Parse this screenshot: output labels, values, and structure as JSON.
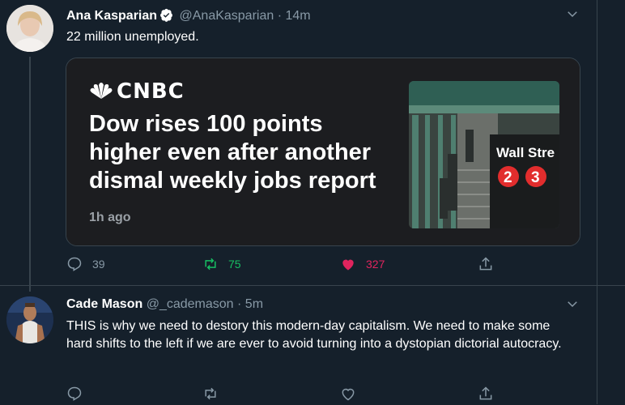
{
  "tweet1": {
    "name": "Ana Kasparian",
    "handle": "@AnaKasparian",
    "time": "· 14m",
    "text": "22 million unemployed.",
    "card": {
      "source": "CNBC",
      "headline": "Dow rises 100 points higher even after another dismal weekly jobs report",
      "time": "1h ago",
      "image_sign": "Wall Stre",
      "train_numbers": [
        "2",
        "3"
      ]
    },
    "actions": {
      "replies": "39",
      "retweets": "75",
      "likes": "327"
    }
  },
  "tweet2": {
    "name": "Cade Mason",
    "handle": "@_cademason",
    "time": "· 5m",
    "text": "THIS is why we need to destory this modern-day capitalism. We need to make some hard shifts to the left if we are ever to avoid turning into a dystopian dictorial autocracy."
  },
  "colors": {
    "background": "#15202b",
    "like": "#e0245e",
    "retweet": "#17bf63",
    "muted": "#8899a6",
    "verified": "#ffffff"
  }
}
